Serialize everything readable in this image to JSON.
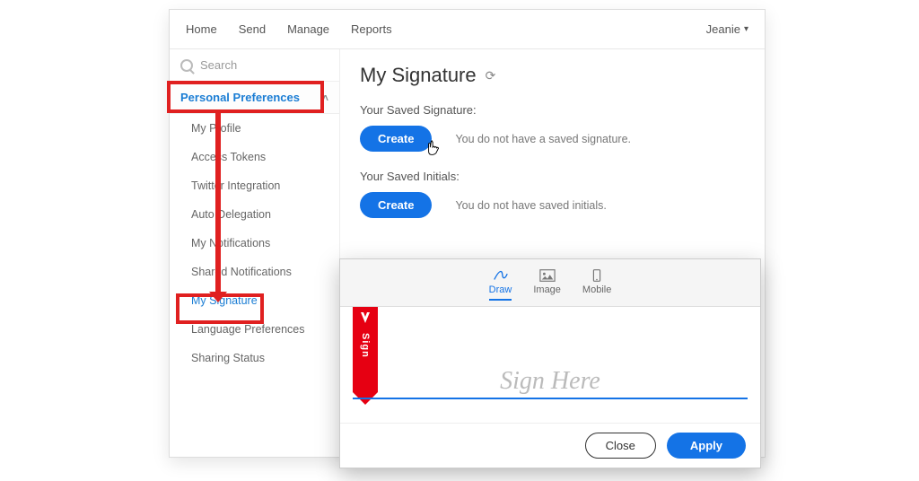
{
  "topnav": {
    "items": [
      "Home",
      "Send",
      "Manage",
      "Reports"
    ],
    "user": "Jeanie"
  },
  "sidebar": {
    "search_placeholder": "Search",
    "section": "Personal Preferences",
    "items": [
      "My Profile",
      "Access Tokens",
      "Twitter Integration",
      "Auto Delegation",
      "My Notifications",
      "Shared Notifications",
      "My Signature",
      "Language Preferences",
      "Sharing Status"
    ],
    "active_index": 6
  },
  "main": {
    "title": "My Signature",
    "signature_label": "Your Saved Signature:",
    "signature_hint": "You do not have a saved signature.",
    "initials_label": "Your Saved Initials:",
    "initials_hint": "You do not have saved initials.",
    "create_label": "Create"
  },
  "dialog": {
    "tabs": [
      "Draw",
      "Image",
      "Mobile"
    ],
    "active_tab": 0,
    "sign_tag": "Sign",
    "placeholder": "Sign Here",
    "close_label": "Close",
    "apply_label": "Apply"
  }
}
